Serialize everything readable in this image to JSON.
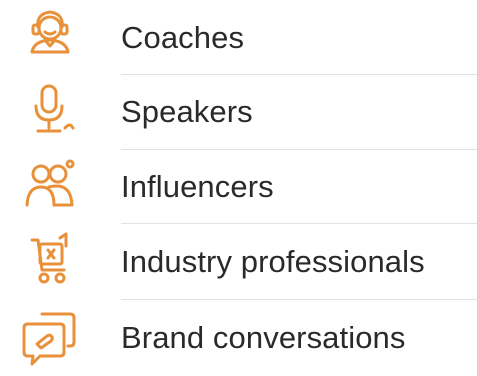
{
  "accent_color": "#e8913a",
  "items": [
    {
      "label": "Coaches",
      "icon": "coach-icon"
    },
    {
      "label": "Speakers",
      "icon": "microphone-icon"
    },
    {
      "label": "Influencers",
      "icon": "people-icon"
    },
    {
      "label": "Industry professionals",
      "icon": "cart-icon"
    },
    {
      "label": "Brand conversations",
      "icon": "chat-bubbles-icon"
    }
  ]
}
